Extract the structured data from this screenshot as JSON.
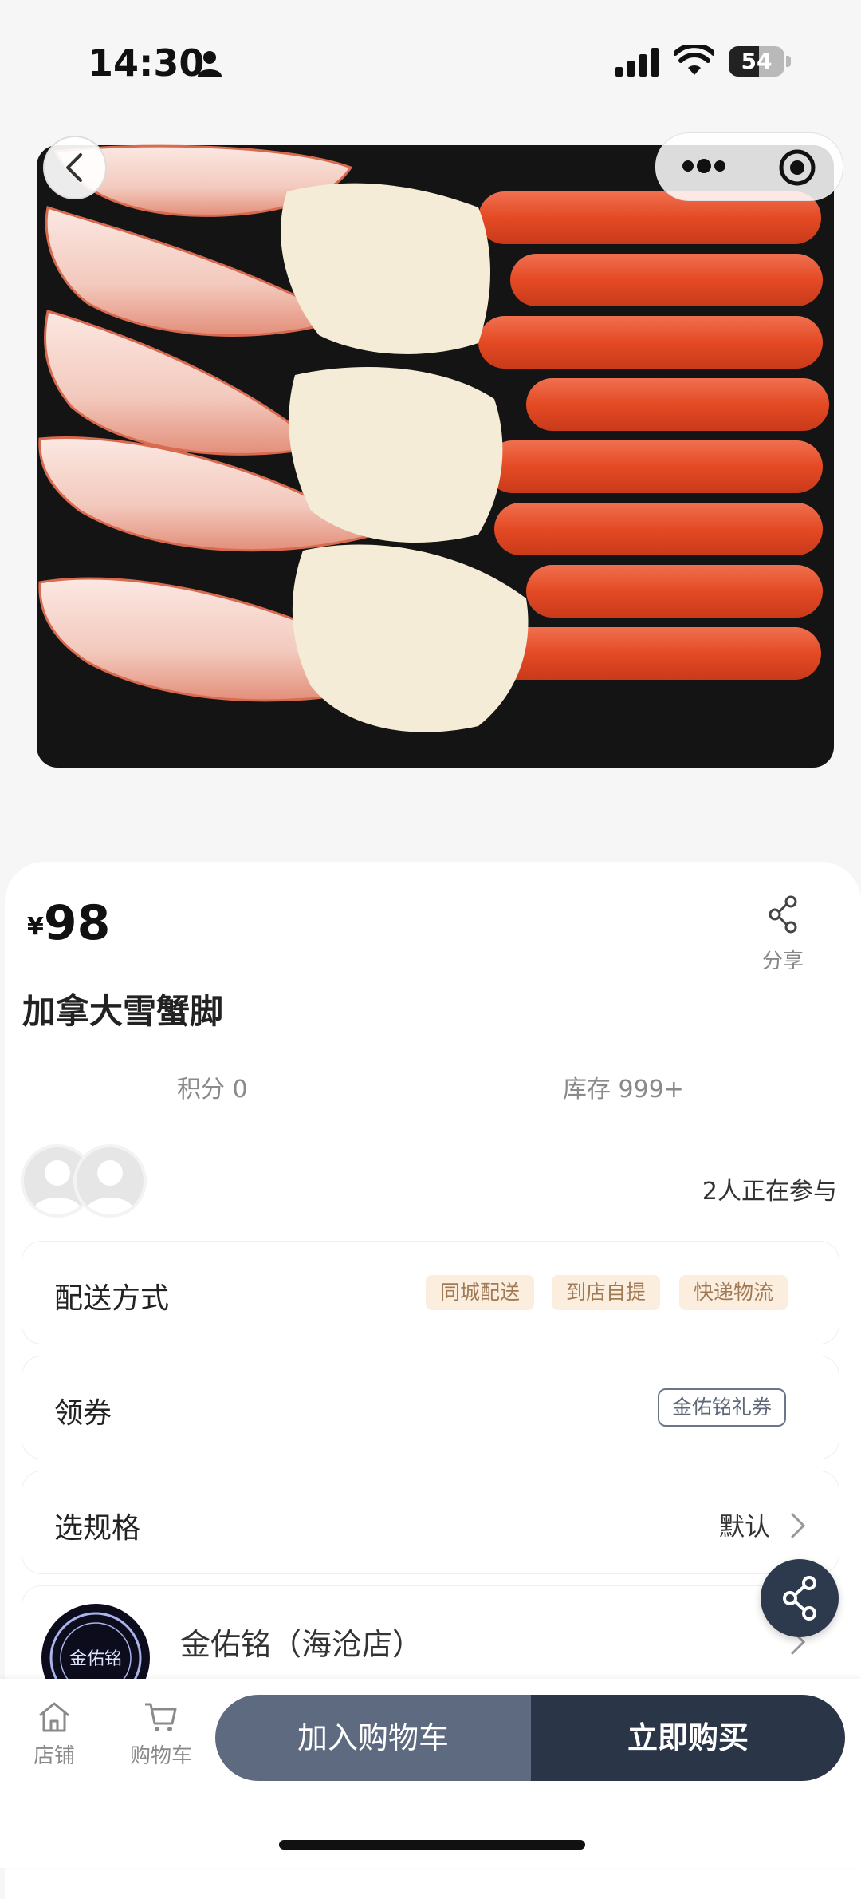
{
  "status_bar": {
    "time": "14:30",
    "battery": "54"
  },
  "product": {
    "currency": "¥",
    "price": "98",
    "title": "加拿大雪蟹脚",
    "points": "积分 0",
    "stock": "库存 999+",
    "participants": "2人正在参与"
  },
  "share_label": "分享",
  "delivery": {
    "label": "配送方式",
    "options": [
      "同城配送",
      "到店自提",
      "快递物流"
    ]
  },
  "coupon": {
    "label": "领券",
    "tag": "金佑铭礼券"
  },
  "spec": {
    "label": "选规格",
    "value": "默认"
  },
  "store": {
    "name": "金佑铭（海沧店）",
    "logo_text": "金佑铭"
  },
  "bottom_nav": {
    "store": "店铺",
    "cart": "购物车"
  },
  "actions": {
    "add_to_cart": "加入购物车",
    "buy_now": "立即购买"
  },
  "colors": {
    "accent_dark": "#2a3547",
    "accent_mid": "#5d6a80",
    "tag_bg": "#fbeede",
    "tag_text": "#a07a55",
    "crab_orange": "#e8522c"
  }
}
